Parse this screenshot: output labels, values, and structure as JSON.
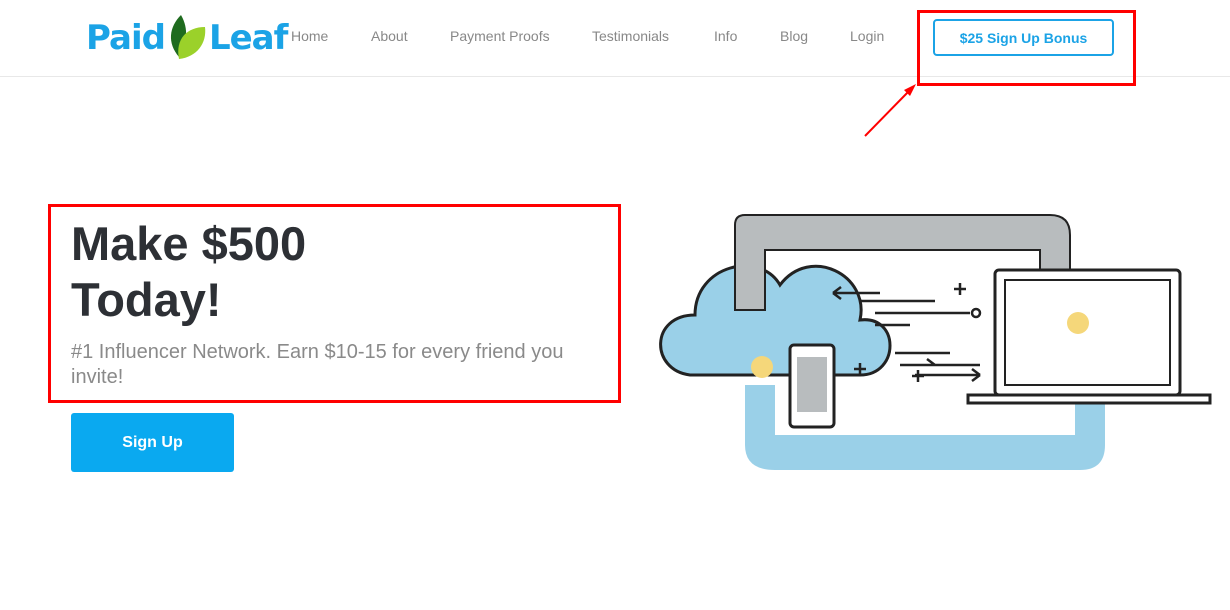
{
  "header": {
    "logo": {
      "text_left": "Paid",
      "text_right": "Leaf",
      "brand_color": "#1ba3e6",
      "leaf_colors": [
        "#1f6b1f",
        "#9bd12a"
      ]
    },
    "nav": [
      {
        "label": "Home"
      },
      {
        "label": "About"
      },
      {
        "label": "Payment Proofs"
      },
      {
        "label": "Testimonials"
      },
      {
        "label": "Info"
      },
      {
        "label": "Blog"
      },
      {
        "label": "Login"
      }
    ],
    "bonus_button": "$25 Sign Up Bonus"
  },
  "hero": {
    "title_line1": "Make $500",
    "title_line2": "Today!",
    "subtitle": "#1 Influencer Network. Earn $10-15 for every friend you invite!",
    "signup_button": "Sign Up",
    "accent_color": "#0aa9f0"
  },
  "annotations": {
    "highlight_color": "#ff0000"
  }
}
